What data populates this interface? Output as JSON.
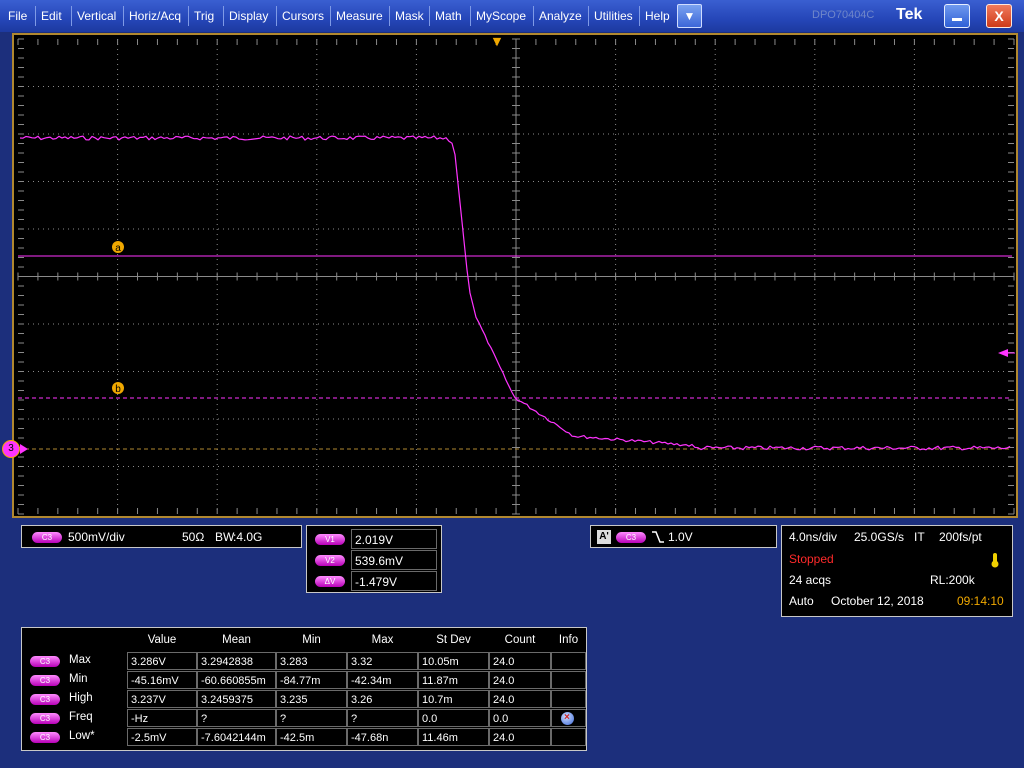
{
  "menu": {
    "items": [
      "File",
      "Edit",
      "Vertical",
      "Horiz/Acq",
      "Trig",
      "Display",
      "Cursors",
      "Measure",
      "Mask",
      "Math",
      "MyScope",
      "Analyze",
      "Utilities",
      "Help"
    ],
    "dropdown_glyph": "▼",
    "ghost_label": "DPO70404C",
    "brand": "Tek",
    "minimize_icon": "minimize-icon",
    "close_label": "X"
  },
  "screen": {
    "trigger_marker": "▼",
    "cursor_a_label": "a",
    "cursor_b_label": "b",
    "channel_marker": "3",
    "trace_color": "#ff33ff",
    "cursor_color": "#ff33ff",
    "grid_color": "#8a8a8a",
    "border_color": "#b08830"
  },
  "channel_panel": {
    "channel": "C3",
    "scale": "500mV/div",
    "impedance": "50Ω",
    "bandwidth_label": "BW",
    "bandwidth": ":4.0G"
  },
  "cursor_panel": {
    "rows": [
      {
        "tag": "V1",
        "value": "2.019V"
      },
      {
        "tag": "V2",
        "value": "539.6mV"
      },
      {
        "tag": "ΔV",
        "value": "-1.479V"
      }
    ]
  },
  "trigger_panel": {
    "a_label": "A'",
    "channel": "C3",
    "slope_icon": "falling-edge-icon",
    "level": "1.0V"
  },
  "horiz_panel": {
    "timebase": "4.0ns/div",
    "sample_rate": "25.0GS/s",
    "mode": "IT",
    "resolution": "200fs/pt",
    "status": "Stopped",
    "acqs": "24 acqs",
    "record_length": "RL:200k",
    "trigger_mode": "Auto",
    "date": "October 12, 2018",
    "time": "09:14:10"
  },
  "measurements": {
    "headers": [
      "Value",
      "Mean",
      "Min",
      "Max",
      "St Dev",
      "Count",
      "Info"
    ],
    "rows": [
      {
        "ch": "C3",
        "name": "Max",
        "value": "3.286V",
        "mean": "3.2942838",
        "min": "3.283",
        "max": "3.32",
        "stdev": "10.05m",
        "count": "24.0",
        "info": ""
      },
      {
        "ch": "C3",
        "name": "Min",
        "value": "-45.16mV",
        "mean": "-60.660855m",
        "min": "-84.77m",
        "max": "-42.34m",
        "stdev": "11.87m",
        "count": "24.0",
        "info": ""
      },
      {
        "ch": "C3",
        "name": "High",
        "value": "3.237V",
        "mean": "3.2459375",
        "min": "3.235",
        "max": "3.26",
        "stdev": "10.7m",
        "count": "24.0",
        "info": ""
      },
      {
        "ch": "C3",
        "name": "Freq",
        "value": "-Hz",
        "mean": "?",
        "min": "?",
        "max": "?",
        "stdev": "0.0",
        "count": "0.0",
        "info": "info-icon"
      },
      {
        "ch": "C3",
        "name": "Low*",
        "value": "-2.5mV",
        "mean": "-7.6042144m",
        "min": "-42.5m",
        "max": "-47.68n",
        "stdev": "11.46m",
        "count": "24.0",
        "info": ""
      }
    ]
  }
}
